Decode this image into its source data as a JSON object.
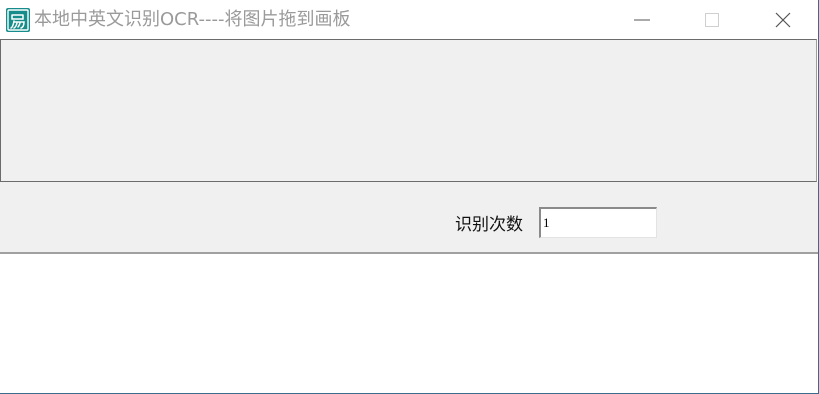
{
  "window": {
    "title": "本地中英文识别OCR----将图片拖到画板",
    "icon": "app-logo-icon",
    "controls": {
      "minimize": "minimize-icon",
      "maximize": "maximize-icon",
      "close": "close-icon"
    }
  },
  "toolbar": {
    "count_label": "识别次数",
    "count_value": "1"
  },
  "colors": {
    "panel_bg": "#f0f0f0",
    "title_text": "#9a9a9a",
    "icon_teal": "#1a8a8a"
  }
}
